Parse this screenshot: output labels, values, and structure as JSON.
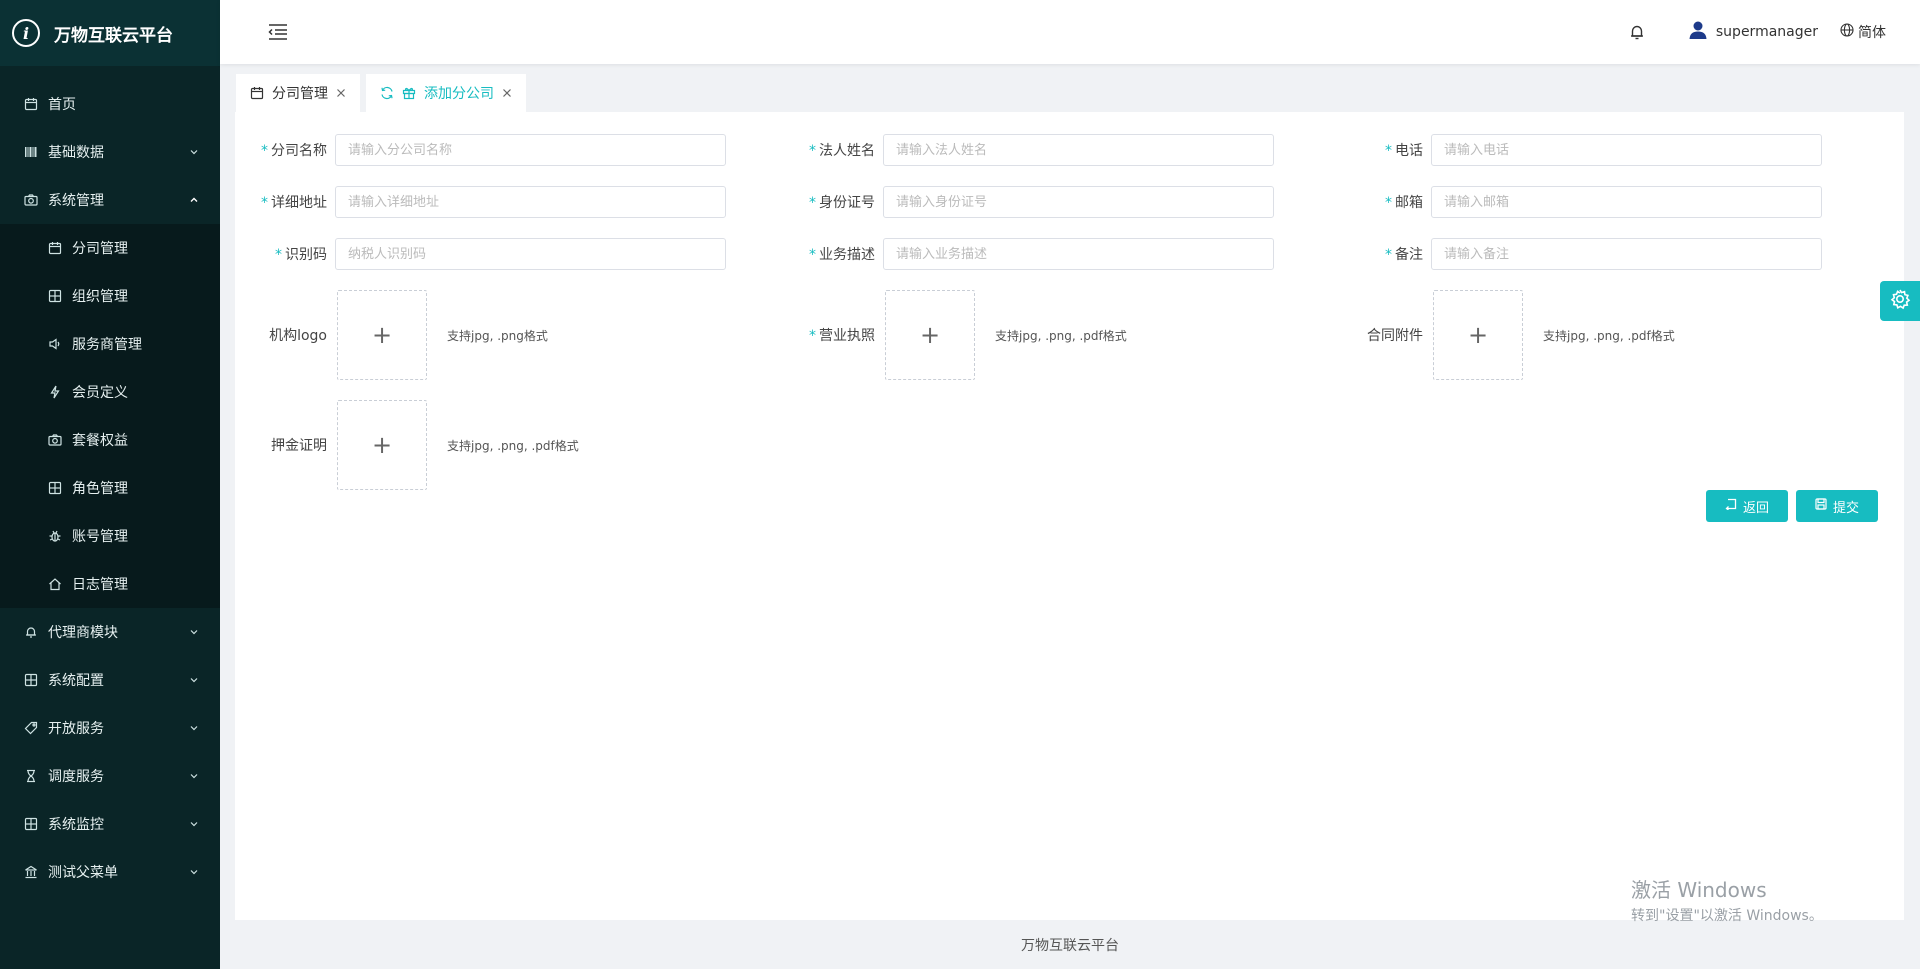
{
  "brand": {
    "logo_letter": "i",
    "title": "万物互联云平台"
  },
  "sidebar": {
    "items": [
      {
        "label": "首页",
        "icon": "calendar-icon"
      },
      {
        "label": "基础数据",
        "icon": "barcode-icon"
      },
      {
        "label": "系统管理",
        "icon": "camera-icon"
      },
      {
        "label": "代理商模块",
        "icon": "bell-icon"
      },
      {
        "label": "系统配置",
        "icon": "grid-icon"
      },
      {
        "label": "开放服务",
        "icon": "tag-icon"
      },
      {
        "label": "调度服务",
        "icon": "hourglass-icon"
      },
      {
        "label": "系统监控",
        "icon": "grid-icon"
      },
      {
        "label": "测试父菜单",
        "icon": "bank-icon"
      }
    ],
    "submenu": [
      {
        "label": "分司管理",
        "icon": "calendar-icon"
      },
      {
        "label": "组织管理",
        "icon": "grid-icon"
      },
      {
        "label": "服务商管理",
        "icon": "speaker-icon"
      },
      {
        "label": "会员定义",
        "icon": "lightning-icon"
      },
      {
        "label": "套餐权益",
        "icon": "camera-icon"
      },
      {
        "label": "角色管理",
        "icon": "grid-icon"
      },
      {
        "label": "账号管理",
        "icon": "bug-icon"
      },
      {
        "label": "日志管理",
        "icon": "home-icon"
      }
    ]
  },
  "header": {
    "username": "supermanager",
    "language": "简体"
  },
  "tabs": [
    {
      "label": "分司管理"
    },
    {
      "label": "添加分公司"
    }
  ],
  "form": {
    "required_mark": "*",
    "fields": [
      {
        "label": "分司名称",
        "placeholder": "请输入分公司名称",
        "required": true
      },
      {
        "label": "法人姓名",
        "placeholder": "请输入法人姓名",
        "required": true
      },
      {
        "label": "电话",
        "placeholder": "请输入电话",
        "required": true
      },
      {
        "label": "详细地址",
        "placeholder": "请输入详细地址",
        "required": true
      },
      {
        "label": "身份证号",
        "placeholder": "请输入身份证号",
        "required": true
      },
      {
        "label": "邮箱",
        "placeholder": "请输入邮箱",
        "required": true
      },
      {
        "label": "识别码",
        "placeholder": "纳税人识别码",
        "required": true
      },
      {
        "label": "业务描述",
        "placeholder": "请输入业务描述",
        "required": true
      },
      {
        "label": "备注",
        "placeholder": "请输入备注",
        "required": true
      }
    ],
    "uploads": [
      {
        "label": "机构logo",
        "hint": "支持jpg, .png格式",
        "required": false
      },
      {
        "label": "营业执照",
        "hint": "支持jpg, .png, .pdf格式",
        "required": true
      },
      {
        "label": "合同附件",
        "hint": "支持jpg, .png, .pdf格式",
        "required": false
      },
      {
        "label": "押金证明",
        "hint": "支持jpg, .png, .pdf格式",
        "required": false
      }
    ],
    "upload_plus": "+",
    "back_label": "返回",
    "submit_label": "提交"
  },
  "footer": {
    "text": "万物互联云平台"
  },
  "watermark": {
    "line1": "激活 Windows",
    "line2": "转到\"设置\"以激活 Windows。"
  },
  "colors": {
    "accent": "#17bcc1",
    "sidebar_bg": "#0a2527",
    "submenu_bg": "#071a1c"
  }
}
